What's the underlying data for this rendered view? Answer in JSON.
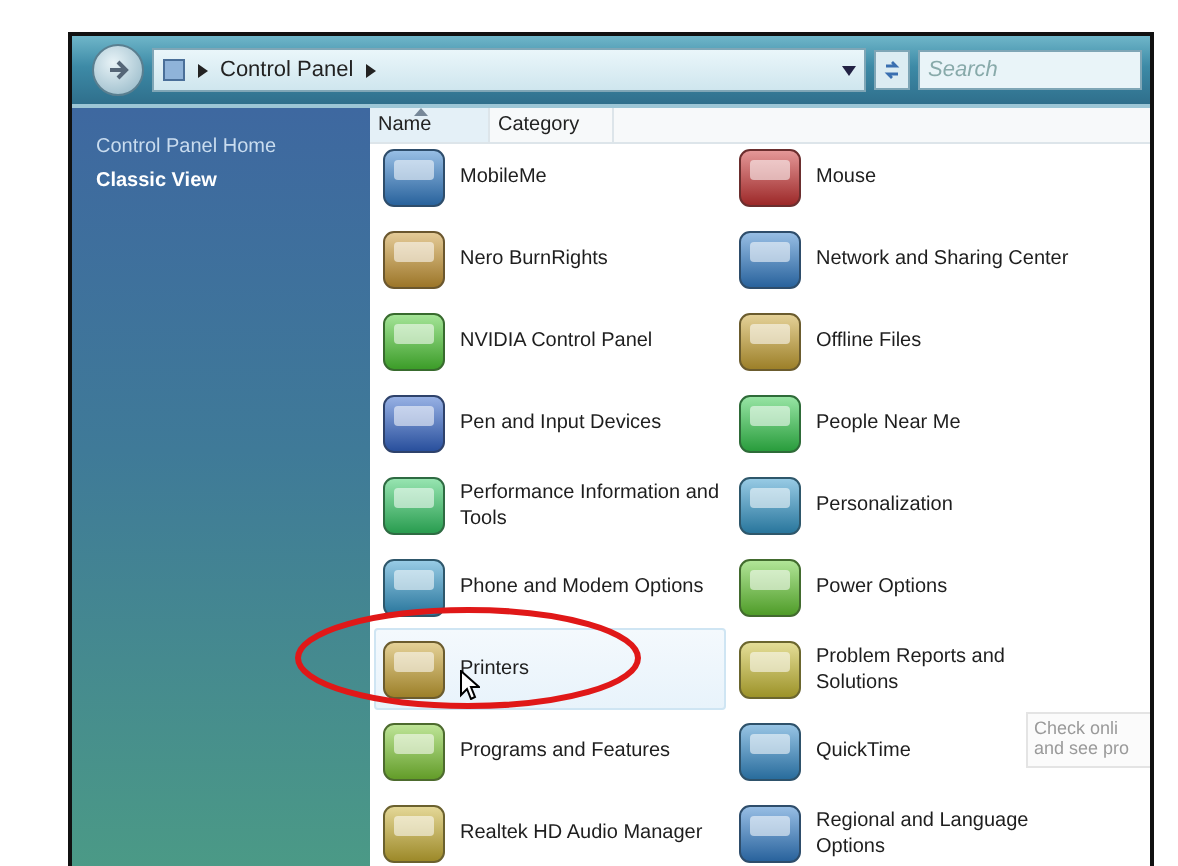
{
  "toolbar": {
    "address": "Control Panel",
    "search_placeholder": "Search"
  },
  "sidebar": {
    "items": [
      {
        "label": "Control Panel Home",
        "selected": false
      },
      {
        "label": "Classic View",
        "selected": true
      }
    ]
  },
  "columns": [
    {
      "label": "Name",
      "sorted": true
    },
    {
      "label": "Category",
      "sorted": false
    }
  ],
  "items": [
    {
      "label": "MobileMe",
      "selected": false
    },
    {
      "label": "Mouse",
      "selected": false
    },
    {
      "label": "Nero BurnRights",
      "selected": false
    },
    {
      "label": "Network and Sharing Center",
      "selected": false
    },
    {
      "label": "NVIDIA Control Panel",
      "selected": false
    },
    {
      "label": "Offline Files",
      "selected": false
    },
    {
      "label": "Pen and Input Devices",
      "selected": false
    },
    {
      "label": "People Near Me",
      "selected": false
    },
    {
      "label": "Performance Information and Tools",
      "selected": false
    },
    {
      "label": "Personalization",
      "selected": false
    },
    {
      "label": "Phone and Modem Options",
      "selected": false
    },
    {
      "label": "Power Options",
      "selected": false
    },
    {
      "label": "Printers",
      "selected": true
    },
    {
      "label": "Problem Reports and Solutions",
      "selected": false
    },
    {
      "label": "Programs and Features",
      "selected": false
    },
    {
      "label": "QuickTime",
      "selected": false
    },
    {
      "label": "Realtek HD Audio Manager",
      "selected": false
    },
    {
      "label": "Regional and Language Options",
      "selected": false
    }
  ],
  "tooltip": {
    "lines": [
      "Check onli",
      "and see pro"
    ]
  },
  "annotation": {
    "kind": "ellipse"
  }
}
